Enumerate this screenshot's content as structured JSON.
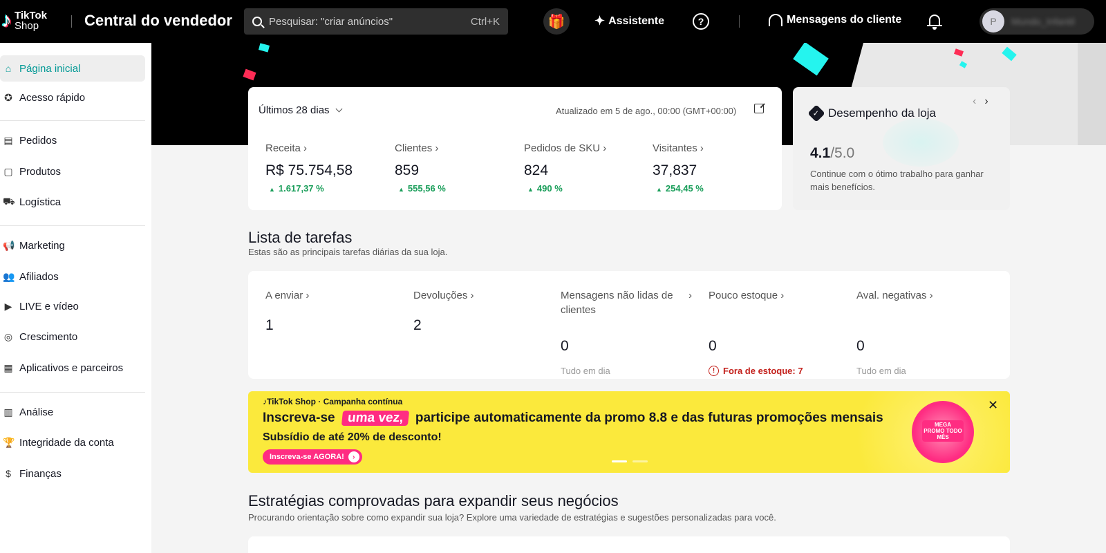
{
  "topbar": {
    "brand_line1": "TikTok",
    "brand_line2": "Shop",
    "title": "Central do vendedor",
    "search_placeholder": "Pesquisar: \"criar anúncios\"",
    "search_shortcut": "Ctrl+K",
    "assistant_label": "Assistente",
    "help_label": "?",
    "messages_label": "Mensagens do cliente",
    "user_name": "Mundo_Infantil",
    "user_initial": "P"
  },
  "sidebar": {
    "items": [
      {
        "label": "Página inicial",
        "icon": "home-icon",
        "active": true
      },
      {
        "label": "Acesso rápido",
        "icon": "star-icon"
      },
      {
        "label": "Pedidos",
        "icon": "clipboard-icon"
      },
      {
        "label": "Produtos",
        "icon": "box-icon"
      },
      {
        "label": "Logística",
        "icon": "truck-icon"
      },
      {
        "label": "Marketing",
        "icon": "megaphone-icon"
      },
      {
        "label": "Afiliados",
        "icon": "users-icon"
      },
      {
        "label": "LIVE e vídeo",
        "icon": "video-icon"
      },
      {
        "label": "Crescimento",
        "icon": "medal-icon"
      },
      {
        "label": "Aplicativos e parceiros",
        "icon": "apps-icon"
      },
      {
        "label": "Análise",
        "icon": "bar-chart-icon"
      },
      {
        "label": "Integridade da conta",
        "icon": "trophy-icon"
      },
      {
        "label": "Finanças",
        "icon": "dollar-icon"
      }
    ]
  },
  "stats": {
    "period": "Últimos 28 dias",
    "updated": "Atualizado em 5 de ago., 00:00 (GMT+00:00)",
    "metrics": [
      {
        "label": "Receita",
        "value": "R$ 75.754,58",
        "change": "1.617,37 %"
      },
      {
        "label": "Clientes",
        "value": "859",
        "change": "555,56 %"
      },
      {
        "label": "Pedidos de SKU",
        "value": "824",
        "change": "490 %"
      },
      {
        "label": "Visitantes",
        "value": "37,837",
        "change": "254,45 %"
      }
    ]
  },
  "performance": {
    "title": "Desempenho da loja",
    "score": "4.1",
    "score_max": "/5.0",
    "description": "Continue com o ótimo trabalho para ganhar mais benefícios."
  },
  "tasks": {
    "title": "Lista de tarefas",
    "subtitle": "Estas são as principais tarefas diárias da sua loja.",
    "items": [
      {
        "label": "A enviar",
        "value": "1",
        "status": ""
      },
      {
        "label": "Devoluções",
        "value": "2",
        "status": ""
      },
      {
        "label": "Mensagens não lidas de clientes",
        "value": "0",
        "status": "Tudo em dia"
      },
      {
        "label": "Pouco estoque",
        "value": "0",
        "status": "Fora de estoque: 7"
      },
      {
        "label": "Aval. negativas",
        "value": "0",
        "status": "Tudo em dia"
      }
    ]
  },
  "banner": {
    "brand": "TikTok Shop",
    "campaign": "Campanha contínua",
    "headline_pre": "Inscreva-se",
    "headline_highlight": "uma vez,",
    "headline_post": "participe automaticamente da promo 8.8 e das futuras promoções mensais",
    "subheadline": "Subsídio de até 20% de desconto!",
    "cta": "Inscreva-se AGORA!",
    "promo_badge": "MEGA PROMO TODO MÊS"
  },
  "strategies": {
    "title": "Estratégias comprovadas para expandir seus negócios",
    "subtitle": "Procurando orientação sobre como expandir sua loja? Explore uma variedade de estratégias e sugestões personalizadas para você."
  },
  "colors": {
    "accent": "#009995",
    "positive": "#1a9e5a",
    "warning": "#c3201b",
    "banner": "#fbe93c",
    "pink": "#ff2c82"
  }
}
